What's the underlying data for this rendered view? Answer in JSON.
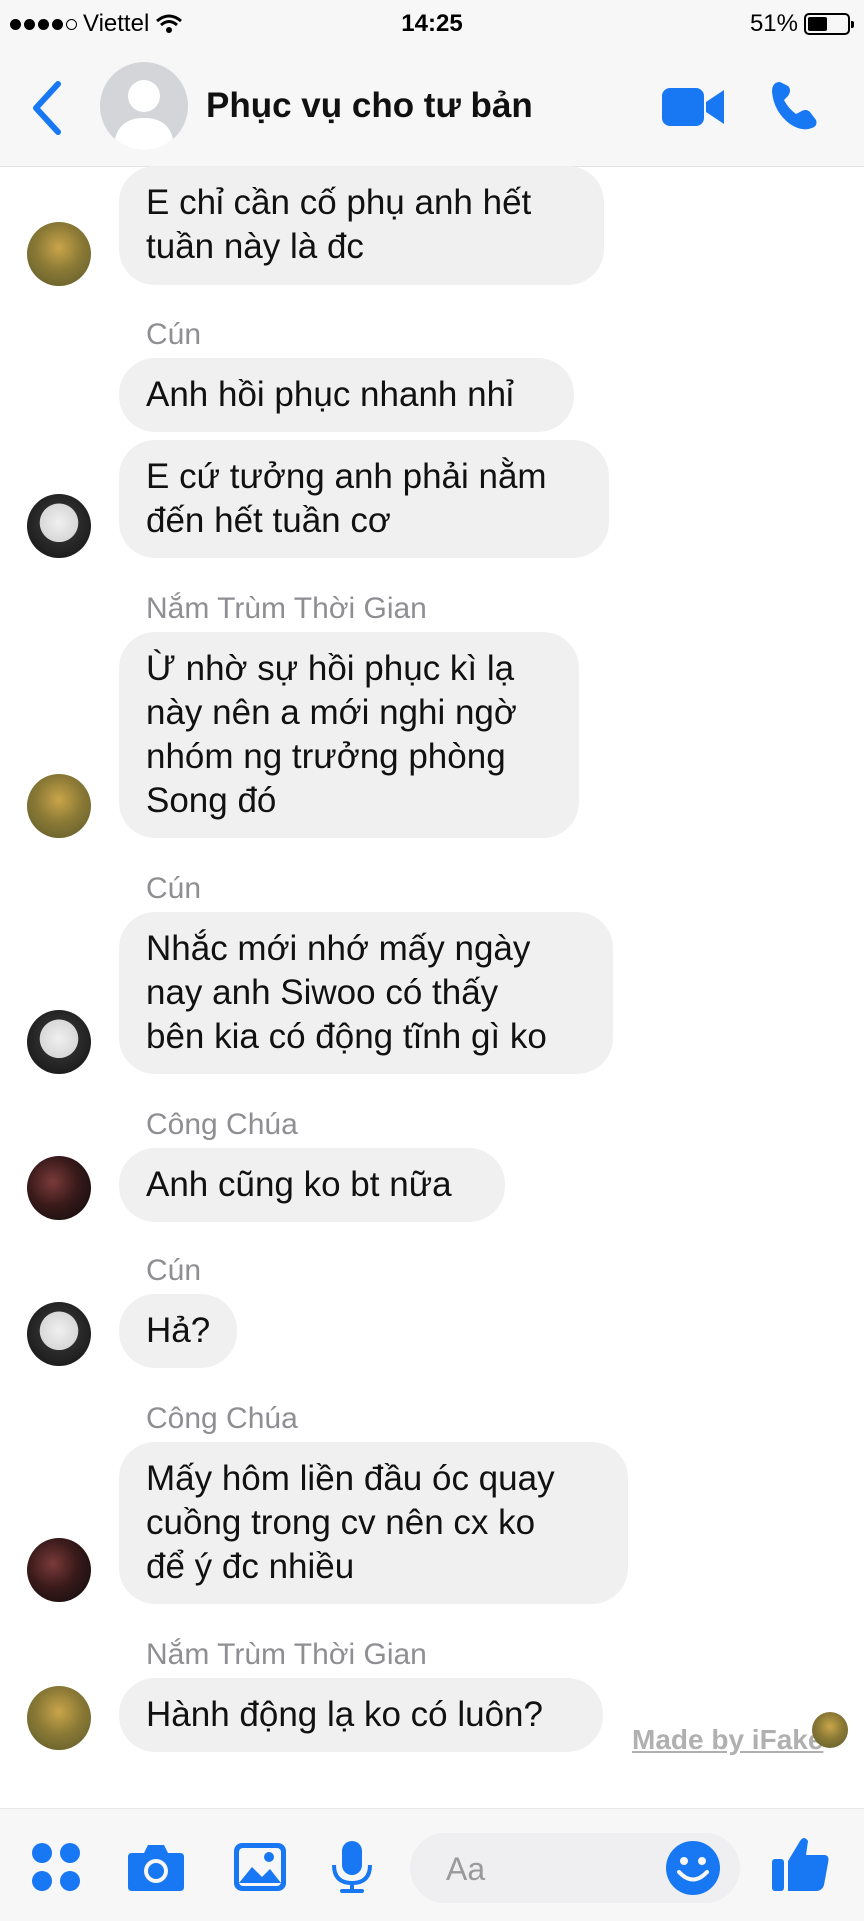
{
  "status_bar": {
    "carrier": "Viettel",
    "time": "14:25",
    "battery": "51%",
    "battery_level": 0.51
  },
  "header": {
    "title": "Phục vụ cho tư bản"
  },
  "messages": [
    {
      "sender": "",
      "text": "E chỉ cần cố phụ anh hết\ntuần này là đc"
    },
    {
      "sender": "Cún",
      "text": "Anh hồi phục nhanh nhỉ"
    },
    {
      "sender": "",
      "text": "E cứ tưởng anh phải nằm\nđến hết tuần cơ"
    },
    {
      "sender": "Nắm Trùm Thời Gian",
      "text": "Ừ nhờ sự hồi phục kì lạ\nnày nên a mới nghi ngờ\nnhóm ng trưởng phòng\nSong đó"
    },
    {
      "sender": "Cún",
      "text": "Nhắc mới nhớ mấy ngày\nnay anh Siwoo có thấy\nbên kia có động tĩnh gì ko"
    },
    {
      "sender": "Công Chúa",
      "text": "Anh cũng ko bt nữa"
    },
    {
      "sender": "Cún",
      "text": "Hả?"
    },
    {
      "sender": "Công Chúa",
      "text": "Mấy hôm liền đầu óc quay\ncuồng trong cv nên cx ko\nđể ý đc nhiều"
    },
    {
      "sender": "Nắm Trùm Thời Gian",
      "text": "Hành động lạ ko có luôn?"
    }
  ],
  "watermark": "Made by iFake",
  "composer": {
    "placeholder": "Aa"
  },
  "colors": {
    "accent": "#1877f2",
    "bubble": "#f0f0f0",
    "sender": "#8e8e93"
  }
}
